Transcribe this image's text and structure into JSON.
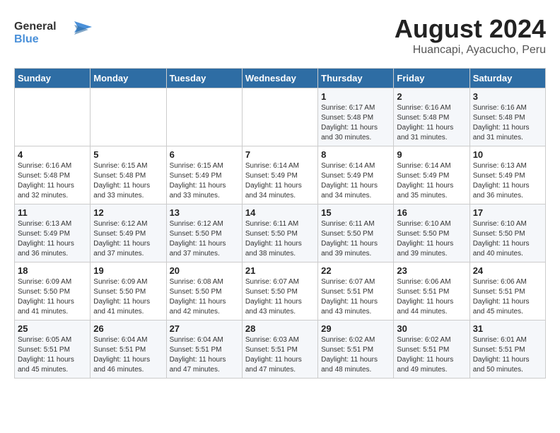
{
  "logo": {
    "text_general": "General",
    "text_blue": "Blue"
  },
  "title": "August 2024",
  "subtitle": "Huancapi, Ayacucho, Peru",
  "days_of_week": [
    "Sunday",
    "Monday",
    "Tuesday",
    "Wednesday",
    "Thursday",
    "Friday",
    "Saturday"
  ],
  "weeks": [
    [
      {
        "day": "",
        "info": ""
      },
      {
        "day": "",
        "info": ""
      },
      {
        "day": "",
        "info": ""
      },
      {
        "day": "",
        "info": ""
      },
      {
        "day": "1",
        "info": "Sunrise: 6:17 AM\nSunset: 5:48 PM\nDaylight: 11 hours and 30 minutes."
      },
      {
        "day": "2",
        "info": "Sunrise: 6:16 AM\nSunset: 5:48 PM\nDaylight: 11 hours and 31 minutes."
      },
      {
        "day": "3",
        "info": "Sunrise: 6:16 AM\nSunset: 5:48 PM\nDaylight: 11 hours and 31 minutes."
      }
    ],
    [
      {
        "day": "4",
        "info": "Sunrise: 6:16 AM\nSunset: 5:48 PM\nDaylight: 11 hours and 32 minutes."
      },
      {
        "day": "5",
        "info": "Sunrise: 6:15 AM\nSunset: 5:48 PM\nDaylight: 11 hours and 33 minutes."
      },
      {
        "day": "6",
        "info": "Sunrise: 6:15 AM\nSunset: 5:49 PM\nDaylight: 11 hours and 33 minutes."
      },
      {
        "day": "7",
        "info": "Sunrise: 6:14 AM\nSunset: 5:49 PM\nDaylight: 11 hours and 34 minutes."
      },
      {
        "day": "8",
        "info": "Sunrise: 6:14 AM\nSunset: 5:49 PM\nDaylight: 11 hours and 34 minutes."
      },
      {
        "day": "9",
        "info": "Sunrise: 6:14 AM\nSunset: 5:49 PM\nDaylight: 11 hours and 35 minutes."
      },
      {
        "day": "10",
        "info": "Sunrise: 6:13 AM\nSunset: 5:49 PM\nDaylight: 11 hours and 36 minutes."
      }
    ],
    [
      {
        "day": "11",
        "info": "Sunrise: 6:13 AM\nSunset: 5:49 PM\nDaylight: 11 hours and 36 minutes."
      },
      {
        "day": "12",
        "info": "Sunrise: 6:12 AM\nSunset: 5:49 PM\nDaylight: 11 hours and 37 minutes."
      },
      {
        "day": "13",
        "info": "Sunrise: 6:12 AM\nSunset: 5:50 PM\nDaylight: 11 hours and 37 minutes."
      },
      {
        "day": "14",
        "info": "Sunrise: 6:11 AM\nSunset: 5:50 PM\nDaylight: 11 hours and 38 minutes."
      },
      {
        "day": "15",
        "info": "Sunrise: 6:11 AM\nSunset: 5:50 PM\nDaylight: 11 hours and 39 minutes."
      },
      {
        "day": "16",
        "info": "Sunrise: 6:10 AM\nSunset: 5:50 PM\nDaylight: 11 hours and 39 minutes."
      },
      {
        "day": "17",
        "info": "Sunrise: 6:10 AM\nSunset: 5:50 PM\nDaylight: 11 hours and 40 minutes."
      }
    ],
    [
      {
        "day": "18",
        "info": "Sunrise: 6:09 AM\nSunset: 5:50 PM\nDaylight: 11 hours and 41 minutes."
      },
      {
        "day": "19",
        "info": "Sunrise: 6:09 AM\nSunset: 5:50 PM\nDaylight: 11 hours and 41 minutes."
      },
      {
        "day": "20",
        "info": "Sunrise: 6:08 AM\nSunset: 5:50 PM\nDaylight: 11 hours and 42 minutes."
      },
      {
        "day": "21",
        "info": "Sunrise: 6:07 AM\nSunset: 5:50 PM\nDaylight: 11 hours and 43 minutes."
      },
      {
        "day": "22",
        "info": "Sunrise: 6:07 AM\nSunset: 5:51 PM\nDaylight: 11 hours and 43 minutes."
      },
      {
        "day": "23",
        "info": "Sunrise: 6:06 AM\nSunset: 5:51 PM\nDaylight: 11 hours and 44 minutes."
      },
      {
        "day": "24",
        "info": "Sunrise: 6:06 AM\nSunset: 5:51 PM\nDaylight: 11 hours and 45 minutes."
      }
    ],
    [
      {
        "day": "25",
        "info": "Sunrise: 6:05 AM\nSunset: 5:51 PM\nDaylight: 11 hours and 45 minutes."
      },
      {
        "day": "26",
        "info": "Sunrise: 6:04 AM\nSunset: 5:51 PM\nDaylight: 11 hours and 46 minutes."
      },
      {
        "day": "27",
        "info": "Sunrise: 6:04 AM\nSunset: 5:51 PM\nDaylight: 11 hours and 47 minutes."
      },
      {
        "day": "28",
        "info": "Sunrise: 6:03 AM\nSunset: 5:51 PM\nDaylight: 11 hours and 47 minutes."
      },
      {
        "day": "29",
        "info": "Sunrise: 6:02 AM\nSunset: 5:51 PM\nDaylight: 11 hours and 48 minutes."
      },
      {
        "day": "30",
        "info": "Sunrise: 6:02 AM\nSunset: 5:51 PM\nDaylight: 11 hours and 49 minutes."
      },
      {
        "day": "31",
        "info": "Sunrise: 6:01 AM\nSunset: 5:51 PM\nDaylight: 11 hours and 50 minutes."
      }
    ]
  ]
}
